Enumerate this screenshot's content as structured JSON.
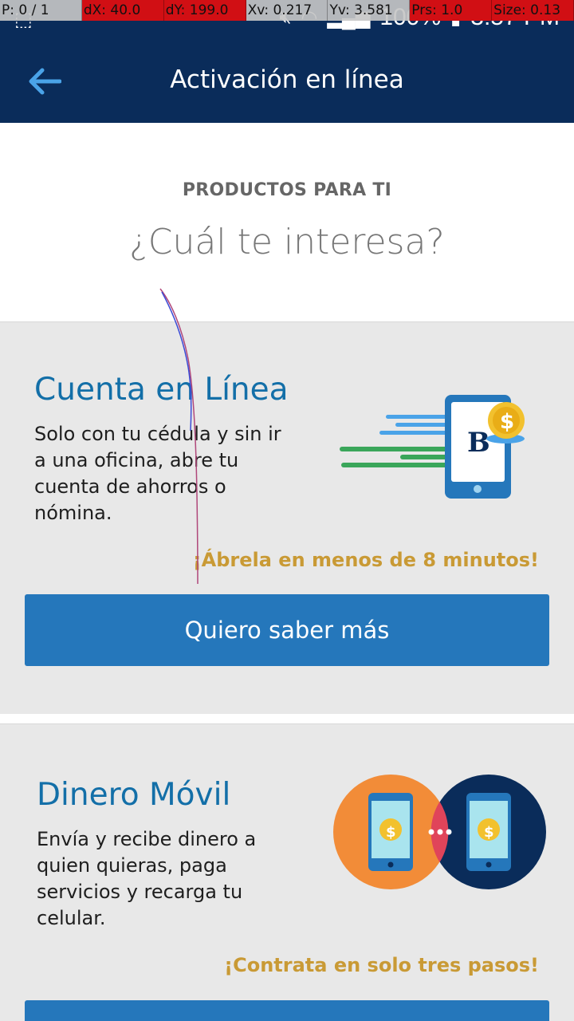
{
  "debug_overlay": {
    "cells": [
      "P: 0 / 1",
      "dX: 40.0",
      "dY: 199.0",
      "Xv: 0.217",
      "Yv: 3.581",
      "Prs: 1.0",
      "Size: 0.13"
    ]
  },
  "status_bar": {
    "battery_text": "100%",
    "time": "3:57 PM"
  },
  "app_bar": {
    "title": "Activación en línea"
  },
  "header": {
    "eyebrow": "PRODUCTOS PARA TI",
    "question": "¿Cuál te interesa?"
  },
  "products": [
    {
      "title": "Cuenta en Línea",
      "description": [
        "Solo con tu cédula  y sin ir",
        "a una oficina, abre tu",
        "cuenta de ahorros o",
        "nómina."
      ],
      "highlight": "¡Ábrela en menos de 8 minutos!",
      "button_label": "Quiero saber más",
      "icon": "phone-bank-icon"
    },
    {
      "title": "Dinero Móvil",
      "description": [
        "Envía y recibe dinero a",
        "quien quieras, paga",
        "servicios y recarga tu",
        "celular."
      ],
      "highlight": "¡Contrata en solo tres pasos!",
      "icon": "phone-transfer-icon"
    }
  ],
  "colors": {
    "brand_navy": "#0a2c5a",
    "button_blue": "#2577bb",
    "title_blue": "#136fa8",
    "highlight_gold": "#c99a35",
    "card_bg": "#e8e8e8"
  }
}
